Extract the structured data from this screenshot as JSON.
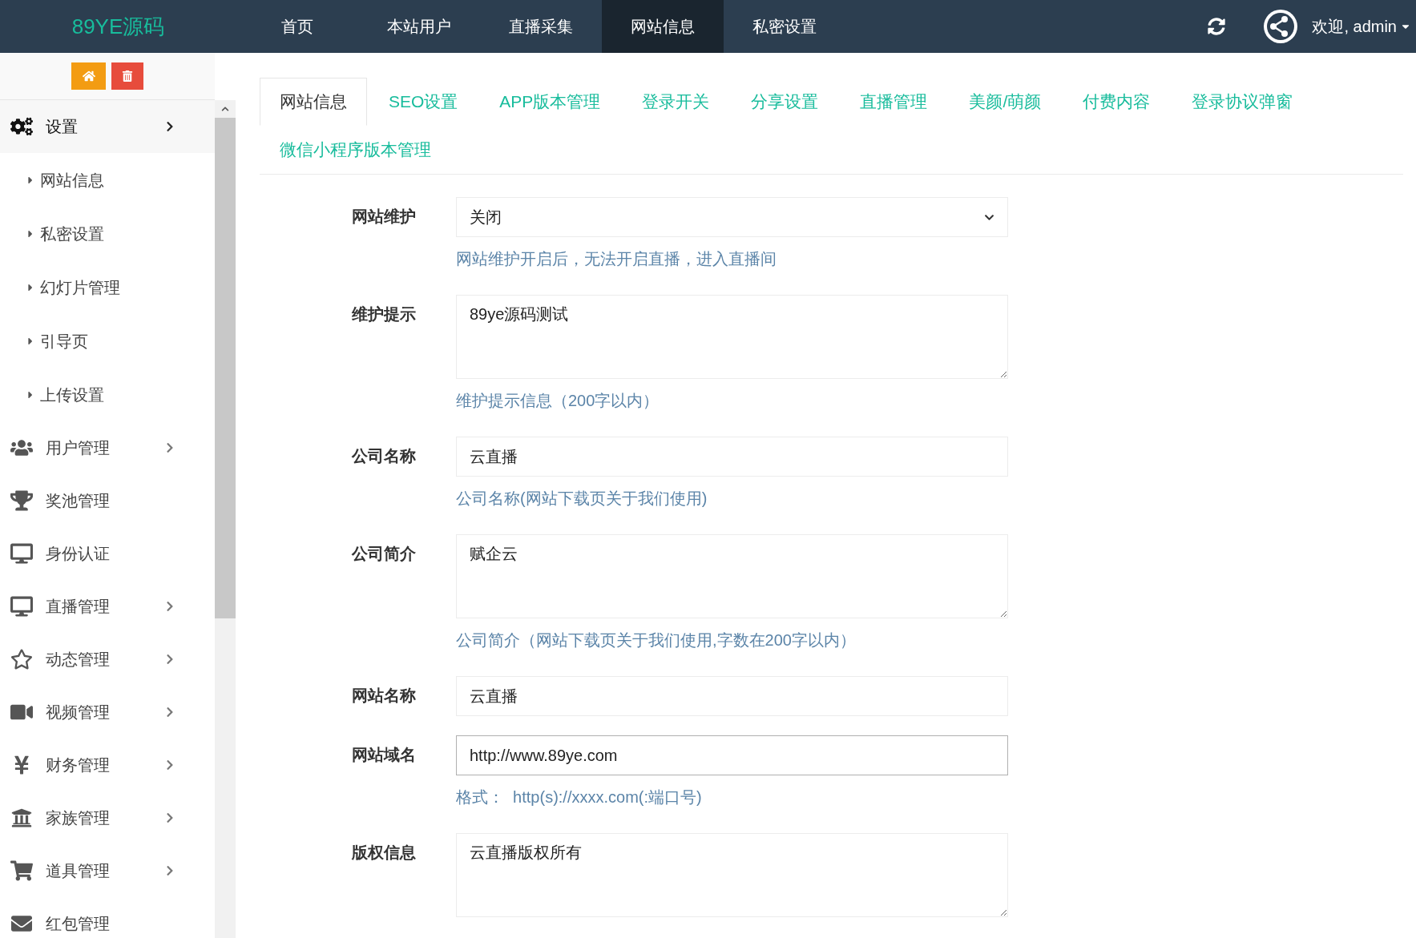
{
  "header": {
    "logo": "89YE源码",
    "nav": [
      {
        "label": "首页",
        "selected": false
      },
      {
        "label": "本站用户",
        "selected": false
      },
      {
        "label": "直播采集",
        "selected": false
      },
      {
        "label": "网站信息",
        "selected": true
      },
      {
        "label": "私密设置",
        "selected": false
      }
    ],
    "user": "欢迎, admin"
  },
  "sidebar": {
    "items": [
      {
        "label": "设置",
        "has_submenu": true,
        "expanded": true,
        "children": [
          {
            "label": "网站信息"
          },
          {
            "label": "私密设置"
          },
          {
            "label": "幻灯片管理"
          },
          {
            "label": "引导页"
          },
          {
            "label": "上传设置"
          }
        ]
      },
      {
        "label": "用户管理",
        "has_submenu": true,
        "expanded": false
      },
      {
        "label": "奖池管理",
        "has_submenu": false
      },
      {
        "label": "身份认证",
        "has_submenu": false
      },
      {
        "label": "直播管理",
        "has_submenu": true,
        "expanded": false
      },
      {
        "label": "动态管理",
        "has_submenu": true,
        "expanded": false
      },
      {
        "label": "视频管理",
        "has_submenu": true,
        "expanded": false
      },
      {
        "label": "财务管理",
        "has_submenu": true,
        "expanded": false
      },
      {
        "label": "家族管理",
        "has_submenu": true,
        "expanded": false
      },
      {
        "label": "道具管理",
        "has_submenu": true,
        "expanded": false
      },
      {
        "label": "红包管理",
        "has_submenu": false
      }
    ]
  },
  "tabs": [
    {
      "label": "网站信息",
      "selected": true
    },
    {
      "label": "SEO设置",
      "selected": false
    },
    {
      "label": "APP版本管理",
      "selected": false
    },
    {
      "label": "登录开关",
      "selected": false
    },
    {
      "label": "分享设置",
      "selected": false
    },
    {
      "label": "直播管理",
      "selected": false
    },
    {
      "label": "美颜/萌颜",
      "selected": false
    },
    {
      "label": "付费内容",
      "selected": false
    },
    {
      "label": "登录协议弹窗",
      "selected": false
    },
    {
      "label": "微信小程序版本管理",
      "selected": false
    }
  ],
  "form": [
    {
      "kind": "select",
      "label": "网站维护",
      "value": "关闭",
      "help": "网站维护开启后，无法开启直播，进入直播间",
      "focused": false
    },
    {
      "kind": "textarea",
      "label": "维护提示",
      "value": "89ye源码测试",
      "help": "维护提示信息（200字以内）",
      "focused": false
    },
    {
      "kind": "input",
      "label": "公司名称",
      "value": "云直播",
      "help": "公司名称(网站下载页关于我们使用)",
      "focused": false
    },
    {
      "kind": "textarea",
      "label": "公司简介",
      "value": "赋企云",
      "help": "公司简介（网站下载页关于我们使用,字数在200字以内）",
      "focused": false
    },
    {
      "kind": "input",
      "label": "网站名称",
      "value": "云直播",
      "focused": false
    },
    {
      "kind": "input",
      "label": "网站域名",
      "value": "http://www.89ye.com",
      "help": "格式：  http(s)://xxxx.com(:端口号)",
      "focused": true
    },
    {
      "kind": "textarea",
      "label": "版权信息",
      "value": "云直播版权所有",
      "focused": false
    }
  ]
}
